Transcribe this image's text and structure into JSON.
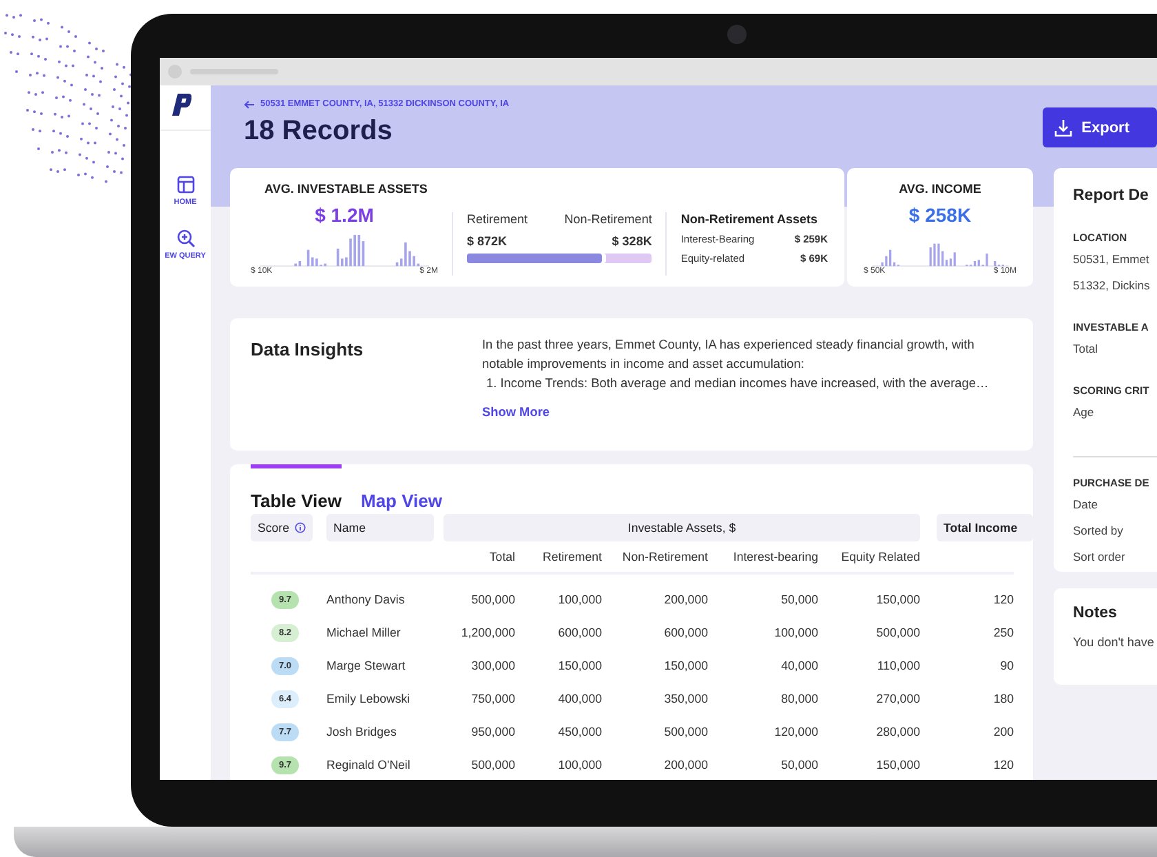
{
  "sidebar": {
    "items": [
      {
        "kind": "home",
        "label": "HOME",
        "selected": false
      },
      {
        "kind": "query",
        "label": "EW QUERY",
        "selected": false
      }
    ]
  },
  "header": {
    "breadcrumb": "50531 EMMET COUNTY, IA, 51332 DICKINSON COUNTY, IA",
    "title": "18 Records",
    "export_button": "Export"
  },
  "investable": {
    "title": "AVG. INVESTABLE ASSETS",
    "value": "$ 1.2M",
    "range_min": "$ 10K",
    "range_max": "$ 2M",
    "split": {
      "left_label": "Retirement",
      "right_label": "Non-Retirement",
      "left_value": "$ 872K",
      "right_value": "$ 328K",
      "level": 0.73
    },
    "breakdown": {
      "title": "Non-Retirement Assets",
      "rows": [
        {
          "label": "Interest-Bearing",
          "value": "$ 259K"
        },
        {
          "label": "Equity-related",
          "value": "$ 69K"
        }
      ]
    }
  },
  "income": {
    "title": "AVG. INCOME",
    "value": "$ 258K",
    "range_min": "$ 50K",
    "range_max": "$ 10M"
  },
  "insights": {
    "title": "Data Insights",
    "paragraph": "In the past three years, Emmet County, IA has experienced steady financial growth, with notable improvements in income and asset accumulation:",
    "list_item": "1. Income Trends: Both average and median incomes have increased, with the average…",
    "link": "Show More"
  },
  "table": {
    "tabs": [
      {
        "label": "Table View",
        "selected": true
      },
      {
        "label": "Map View",
        "selected": false
      }
    ],
    "score_header": "Score",
    "name_header": "Name",
    "group_header": "Investable Assets, $",
    "income_header": "Total Income",
    "sub_columns": [
      "Total",
      "Retirement",
      "Non-Retirement",
      "Interest-bearing",
      "Equity Related"
    ],
    "rows": [
      {
        "score": "9.7",
        "color": "#b5e2ae",
        "name": "Anthony Davis",
        "values": [
          "500,000",
          "100,000",
          "200,000",
          "50,000",
          "150,000"
        ],
        "income": "120"
      },
      {
        "score": "8.2",
        "color": "#d6efd2",
        "name": "Michael Miller",
        "values": [
          "1,200,000",
          "600,000",
          "600,000",
          "100,000",
          "500,000"
        ],
        "income": "250"
      },
      {
        "score": "7.0",
        "color": "#bcdcf6",
        "name": "Marge Stewart",
        "values": [
          "300,000",
          "150,000",
          "150,000",
          "40,000",
          "110,000"
        ],
        "income": "90"
      },
      {
        "score": "6.4",
        "color": "#dcedfb",
        "name": "Emily Lebowski",
        "values": [
          "750,000",
          "400,000",
          "350,000",
          "80,000",
          "270,000"
        ],
        "income": "180"
      },
      {
        "score": "7.7",
        "color": "#bcdcf6",
        "name": "Josh Bridges",
        "values": [
          "950,000",
          "450,000",
          "500,000",
          "120,000",
          "280,000"
        ],
        "income": "200"
      },
      {
        "score": "9.7",
        "color": "#b5e2ae",
        "name": "Reginald O'Neil",
        "values": [
          "500,000",
          "100,000",
          "200,000",
          "50,000",
          "150,000"
        ],
        "income": "120"
      }
    ]
  },
  "report": {
    "title": "Report De",
    "sections": [
      {
        "heading": "LOCATION",
        "items": [
          "50531, Emmet",
          "51332, Dickins"
        ],
        "rule_before": false
      },
      {
        "heading": "INVESTABLE A",
        "items": [
          "Total"
        ],
        "rule_before": false
      },
      {
        "heading": "SCORING CRIT",
        "items": [
          "Age"
        ],
        "rule_before": false
      },
      {
        "heading": "PURCHASE DE",
        "items": [
          "Date",
          "Sorted by",
          "Sort order"
        ],
        "rule_before": true
      }
    ]
  },
  "notes": {
    "title": "Notes",
    "text": "You don't have"
  }
}
